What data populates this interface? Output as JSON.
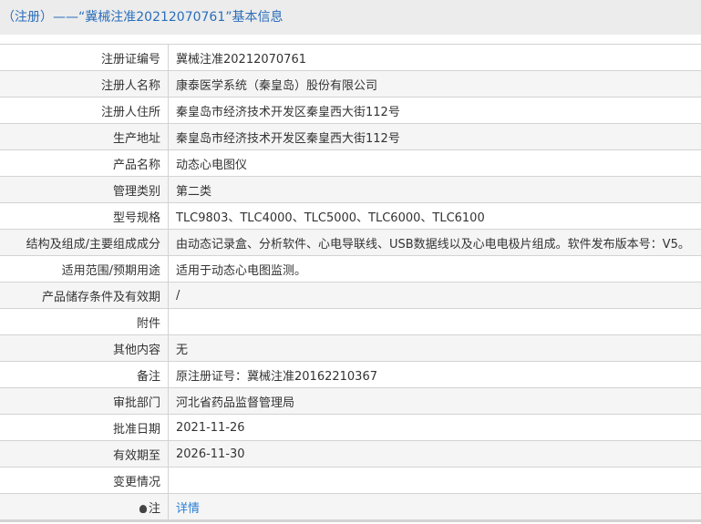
{
  "title": "（注册）——“冀械注准20212070761”基本信息",
  "rows": [
    {
      "label": "注册证编号",
      "value": "冀械注准20212070761"
    },
    {
      "label": "注册人名称",
      "value": "康泰医学系统（秦皇岛）股份有限公司"
    },
    {
      "label": "注册人住所",
      "value": "秦皇岛市经济技术开发区秦皇西大街112号"
    },
    {
      "label": "生产地址",
      "value": "秦皇岛市经济技术开发区秦皇西大街112号"
    },
    {
      "label": "产品名称",
      "value": "动态心电图仪"
    },
    {
      "label": "管理类别",
      "value": "第二类"
    },
    {
      "label": "型号规格",
      "value": "TLC9803、TLC4000、TLC5000、TLC6000、TLC6100"
    },
    {
      "label": "结构及组成/主要组成成分",
      "value": "由动态记录盒、分析软件、心电导联线、USB数据线以及心电电极片组成。软件发布版本号：V5。"
    },
    {
      "label": "适用范围/预期用途",
      "value": "适用于动态心电图监测。"
    },
    {
      "label": "产品储存条件及有效期",
      "value": "/"
    },
    {
      "label": "附件",
      "value": ""
    },
    {
      "label": "其他内容",
      "value": "无"
    },
    {
      "label": "备注",
      "value": "原注册证号：冀械注准20162210367"
    },
    {
      "label": "审批部门",
      "value": "河北省药品监督管理局"
    },
    {
      "label": "批准日期",
      "value": "2021-11-26"
    },
    {
      "label": "有效期至",
      "value": "2026-11-30"
    },
    {
      "label": "变更情况",
      "value": ""
    }
  ],
  "note": {
    "label": "注",
    "link": "详情",
    "icon": "lightbulb-icon"
  }
}
